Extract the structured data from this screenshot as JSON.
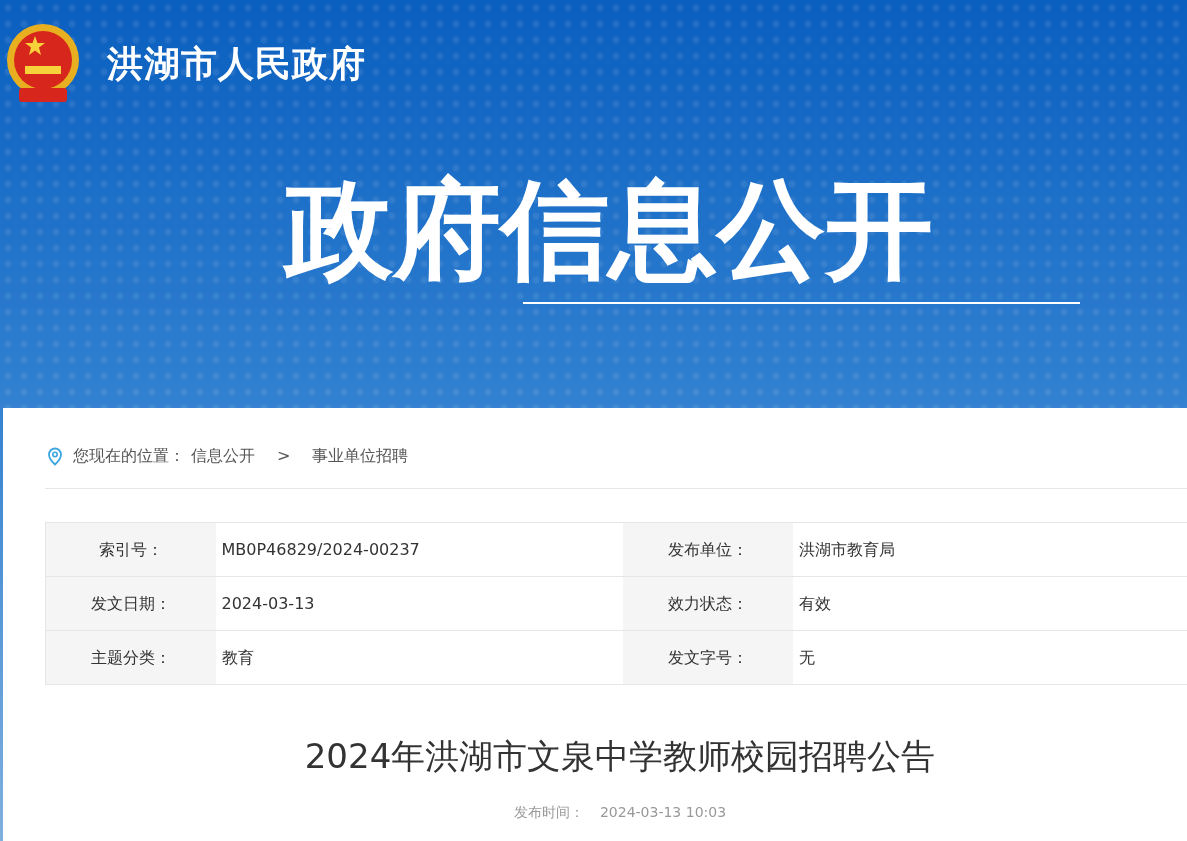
{
  "header": {
    "site_name": "洪湖市人民政府",
    "banner_title": "政府信息公开"
  },
  "breadcrumb": {
    "label": "您现在的位置：",
    "separator": ">",
    "items": [
      {
        "text": "信息公开"
      },
      {
        "text": "事业单位招聘"
      }
    ]
  },
  "meta": [
    [
      {
        "label": "索引号：",
        "value": "MB0P46829/2024-00237"
      },
      {
        "label": "发布单位：",
        "value": "洪湖市教育局"
      }
    ],
    [
      {
        "label": "发文日期：",
        "value": "2024-03-13"
      },
      {
        "label": "效力状态：",
        "value": "有效"
      }
    ],
    [
      {
        "label": "主题分类：",
        "value": "教育"
      },
      {
        "label": "发文字号：",
        "value": "无"
      }
    ]
  ],
  "article": {
    "title": "2024年洪湖市文泉中学教师校园招聘公告",
    "publish_label": "发布时间：",
    "publish_time": "2024-03-13 10:03"
  }
}
